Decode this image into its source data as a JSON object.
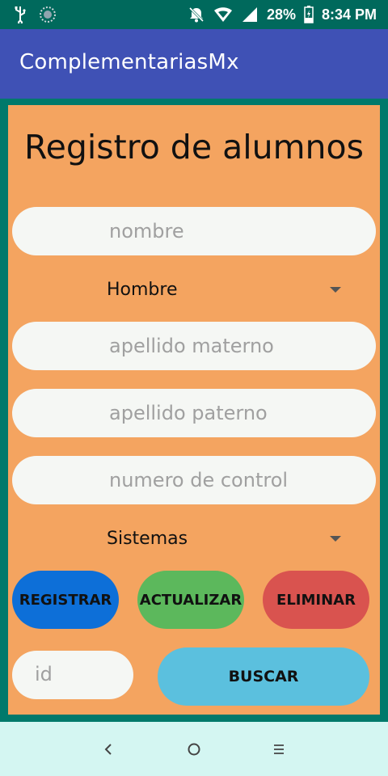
{
  "status_bar": {
    "battery": "28%",
    "time": "8:34 PM",
    "icons": [
      "usb-icon",
      "sync-icon",
      "mute-icon",
      "wifi-icon",
      "signal-icon",
      "battery-icon"
    ]
  },
  "app_bar": {
    "title": "ComplementariasMx"
  },
  "form": {
    "title": "Registro de alumnos",
    "nombre_placeholder": "nombre",
    "sexo_selected": "Hombre",
    "apellido_materno_placeholder": "apellido materno",
    "apellido_paterno_placeholder": "apellido paterno",
    "numero_control_placeholder": "numero de control",
    "carrera_selected": "Sistemas",
    "registrar_label": "REGISTRAR",
    "actualizar_label": "ACTUALIZAR",
    "eliminar_label": "ELIMINAR",
    "id_placeholder": "id",
    "buscar_label": "BUSCAR"
  },
  "colors": {
    "status_bar": "#00695c",
    "app_bar": "#3f51b5",
    "background": "#00796b",
    "panel": "#f4a460",
    "registrar": "#0d6fd8",
    "actualizar": "#5cb85c",
    "eliminar": "#d9534f",
    "buscar": "#5bc0de",
    "nav_bar": "#d4f6f2"
  },
  "nav_bar": {
    "icons": [
      "back-icon",
      "home-icon",
      "menu-icon"
    ]
  }
}
